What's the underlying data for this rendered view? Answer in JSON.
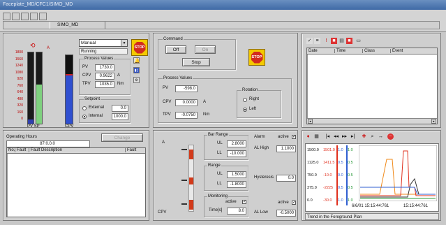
{
  "window": {
    "title": "Faceplate_MD/CFC1/SIMO_MD",
    "tab_label": "SIMO_MD"
  },
  "motor": {
    "mode_select": "Manual",
    "status_text": "Running",
    "process_values_title": "Process Values",
    "pv_label": "PV",
    "pv_value": "1730.0",
    "cpv_label": "CPV",
    "cpv_value": "0.9622",
    "cpv_unit": "A",
    "tpv_label": "TPV",
    "tpv_value": "1035.0",
    "tpv_unit": "Nm",
    "setpoint_title": "Setpoint",
    "external_label": "External",
    "external_value": "0.0",
    "internal_label": "Internal",
    "internal_value": "1000.0",
    "bar_unit": "A",
    "scale": [
      "1800",
      "1560",
      "1240",
      "1080",
      "920",
      "760",
      "640",
      "480",
      "320",
      "160",
      "0"
    ],
    "bar1_caption": "PV SP",
    "bar2_caption": "CPV",
    "pv_level_fraction": 0.06,
    "sp_level_fraction": 0.55,
    "cpv_level_fraction": 0.72
  },
  "command": {
    "title": "Command",
    "off_label": "Off",
    "on_label": "On",
    "stop_label": "Stop",
    "stop_sign_text": "STOP"
  },
  "process": {
    "title": "Process Values",
    "pv_label": "PV",
    "pv_value": "-598.0",
    "cpv_label": "CPV",
    "cpv_value": "0.0000",
    "cpv_unit": "A",
    "tpv_label": "TPV",
    "tpv_value": "-0.0750",
    "tpv_unit": "Nm",
    "rotation_title": "Rotation",
    "right_label": "Right",
    "left_label": "Left"
  },
  "events": {
    "columns": [
      "Date",
      "Time",
      "Class",
      "Event"
    ]
  },
  "operating": {
    "hours_label": "Operating Hours",
    "hours_value": "87:0.0.0",
    "reset_label": "Change",
    "columns": [
      "No.",
      "Fault",
      "Fault Description",
      "Fault"
    ]
  },
  "limits": {
    "a_label": "A",
    "cpv_label": "CPV",
    "bar_range_title": "Bar Range",
    "ul_label": "UL",
    "bar_ul": "2.8000",
    "ll_label": "LL",
    "bar_ll": "-10.000",
    "range_title": "Range",
    "range_ul": "1.5000",
    "range_ll": "-1.8000",
    "monitoring_title": "Monitoring",
    "monitoring_active": "active",
    "time_label": "Time[s]",
    "time_value": "8.0",
    "alarm_title": "Alarm",
    "alarm_active": "active",
    "al_high_label": "AL High",
    "al_high_value": "1.1000",
    "hysteresis_label": "Hysteresis",
    "hysteresis_value": "0.0",
    "al_low_active": "active",
    "al_low_label": "AL Low",
    "al_low_value": "-0.5000"
  },
  "trend": {
    "status_text": "Trend in the Foreground",
    "status_right": "Plan",
    "date_label": "6/6/01 15:15:44:761",
    "time_label": "15:15:44:761",
    "col1": [
      "1500.0",
      "1125.0",
      "750.0",
      "375.0",
      "0.0"
    ],
    "col2": [
      "1501.0",
      "1411.5",
      "-10.0",
      "-2225",
      "-30.0"
    ],
    "col3": [
      "1.0",
      "0.5",
      "0.0",
      "0.5",
      "1.0"
    ],
    "col4": [
      "1.0",
      "0.5",
      "0.5",
      "0.5",
      "1.0"
    ],
    "colors": {
      "red": "#e0301e",
      "blue": "#2f5fd0",
      "orange": "#f08a1a",
      "green": "#2a9a3a"
    }
  }
}
